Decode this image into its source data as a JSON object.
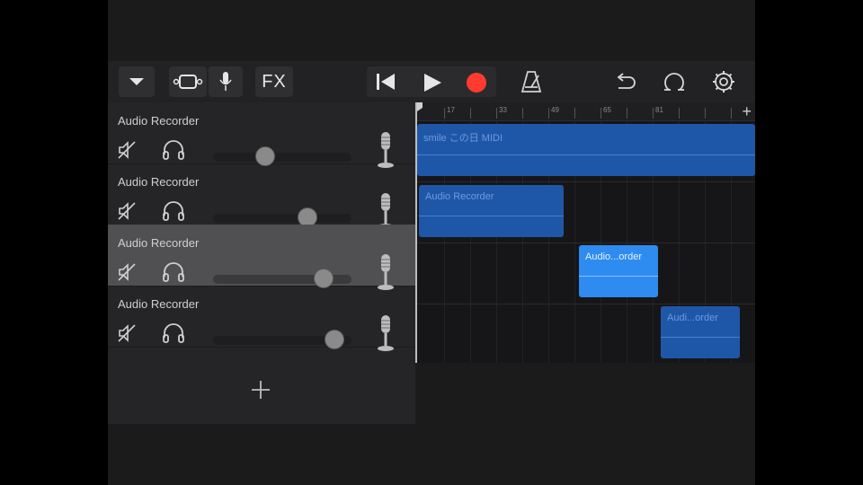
{
  "toolbar": {
    "fx_label": "FX",
    "record_color": "#ff3b30"
  },
  "tracks": [
    {
      "name": "Audio Recorder",
      "volume": 0.33,
      "selected": false
    },
    {
      "name": "Audio Recorder",
      "volume": 0.66,
      "selected": false
    },
    {
      "name": "Audio Recorder",
      "volume": 0.78,
      "selected": true
    },
    {
      "name": "Audio Recorder",
      "volume": 0.87,
      "selected": false
    }
  ],
  "ruler": {
    "labels": [
      "17",
      "33",
      "49",
      "65",
      "81"
    ]
  },
  "regions": [
    {
      "label": "smile この日 MIDI"
    },
    {
      "label": "Audio Recorder"
    },
    {
      "label": "Audio...order"
    },
    {
      "label": "Audi...order"
    }
  ],
  "colors": {
    "accent_region": "#1f57a8",
    "selected_region": "#2e8bef"
  }
}
